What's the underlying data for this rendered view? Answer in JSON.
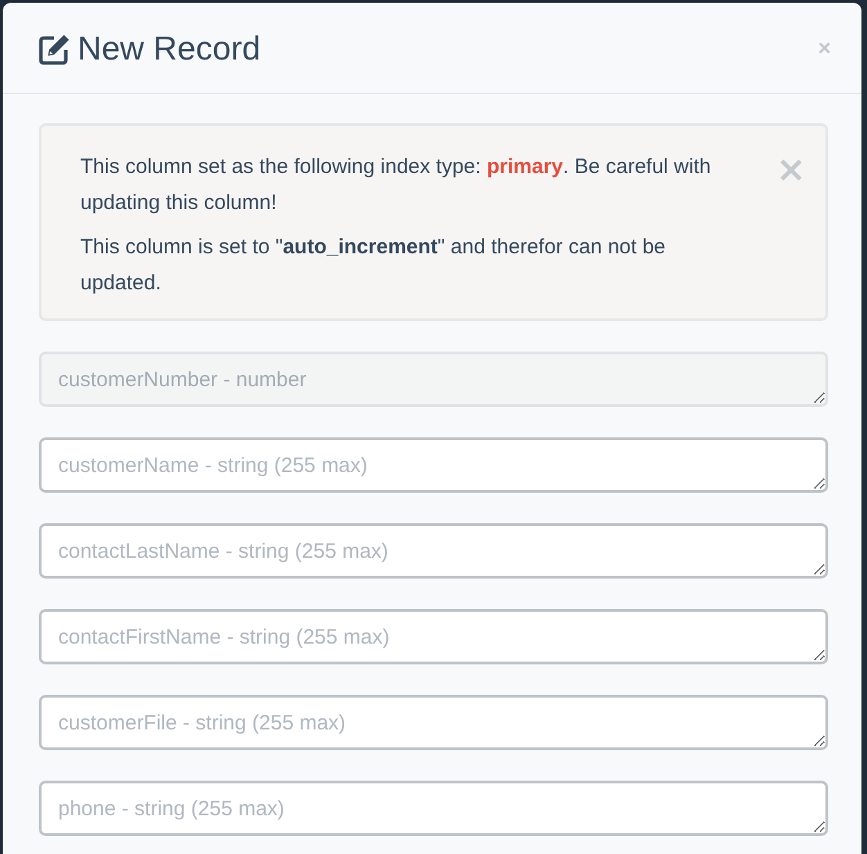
{
  "modal": {
    "title": "New Record",
    "close": "×"
  },
  "alert": {
    "messages": [
      {
        "kind": "warning",
        "text": "This column set as the following index type: **primary**. Be careful with updating this column!"
      },
      {
        "kind": "info",
        "text": "This column is set to \"**auto_increment**\" and therefor can not be updated."
      }
    ],
    "dismiss": "×"
  },
  "fields": [
    {
      "placeholder": "customerNumber - number",
      "disabled": true
    },
    {
      "placeholder": "customerName - string (255 max)",
      "disabled": false
    },
    {
      "placeholder": "contactLastName - string (255 max)",
      "disabled": false
    },
    {
      "placeholder": "contactFirstName - string (255 max)",
      "disabled": false
    },
    {
      "placeholder": "customerFile - string (255 max)",
      "disabled": false
    },
    {
      "placeholder": "phone - string (255 max)",
      "disabled": false
    }
  ]
}
